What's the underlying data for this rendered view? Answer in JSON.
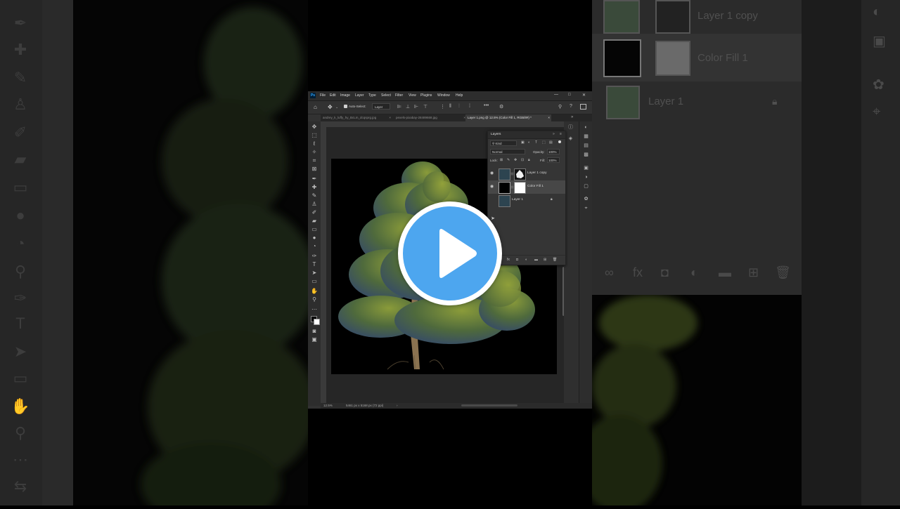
{
  "app": {
    "menu": [
      "File",
      "Edit",
      "Image",
      "Layer",
      "Type",
      "Select",
      "Filter",
      "View",
      "Plugins",
      "Window",
      "Help"
    ],
    "window_controls": [
      "—",
      "□",
      "✕"
    ]
  },
  "options_bar": {
    "auto_select_label": "Auto-Select:",
    "auto_select_value": "Layer",
    "more_label": "•••"
  },
  "tabs": [
    {
      "label": "andrey_k_luffy_hy_BcLm_dcqsprg.jpg",
      "close": "×"
    },
    {
      "label": "pexels-pixabay-28489668.jpg",
      "close": "×"
    },
    {
      "label": "Layer 1.png @ 12.5% (Color Fill 1, RGB/8#) *",
      "close": "×"
    }
  ],
  "status": {
    "zoom": "12.5%",
    "dimensions": "5461 px x 5168 px (72 ppi)"
  },
  "layers_panel": {
    "title": "Layers",
    "filter_kind": "Kind",
    "blend_mode": "Normal",
    "opacity_label": "Opacity:",
    "opacity_value": "100%",
    "lock_label": "Lock:",
    "fill_label": "Fill:",
    "fill_value": "100%",
    "layers": [
      {
        "name": "Layer 1 copy",
        "selected": false
      },
      {
        "name": "Color Fill 1",
        "selected": true
      },
      {
        "name": "Layer 1",
        "selected": false,
        "locked": true
      }
    ]
  },
  "background_zoom": {
    "layers": [
      "Layer 1 copy",
      "Color Fill 1",
      "Layer 1"
    ]
  },
  "colors": {
    "accent": "#4da6ef",
    "ps_logo": "#31a8ff"
  }
}
